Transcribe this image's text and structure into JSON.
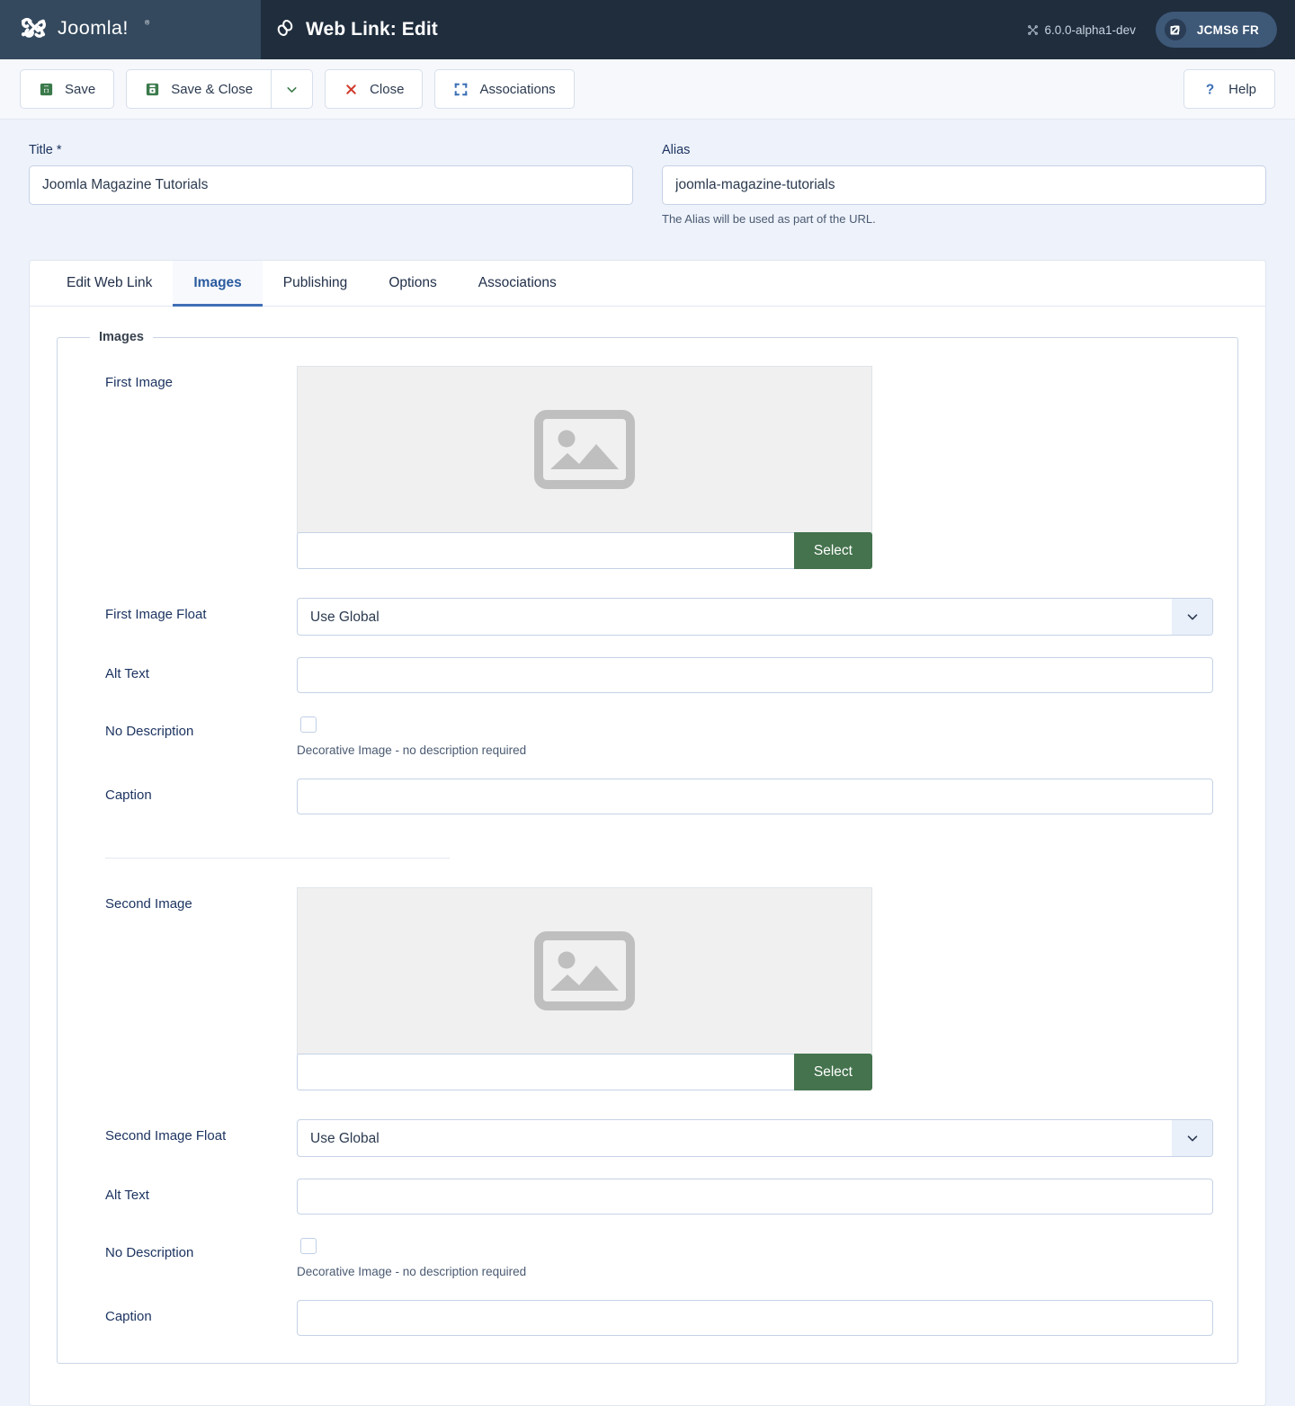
{
  "header": {
    "brand_name": "Joomla!",
    "page_title": "Web Link: Edit",
    "link_icon": "chain-link-icon",
    "version": "6.0.0-alpha1-dev",
    "user_label": "JCMS6 FR"
  },
  "toolbar": {
    "save_label": "Save",
    "save_close_label": "Save & Close",
    "close_label": "Close",
    "associations_label": "Associations",
    "help_label": "Help"
  },
  "fields": {
    "title_label": "Title *",
    "title_value": "Joomla Magazine Tutorials",
    "alias_label": "Alias",
    "alias_value": "joomla-magazine-tutorials",
    "alias_hint": "The Alias will be used as part of the URL."
  },
  "tabs": [
    {
      "label": "Edit Web Link",
      "active": false
    },
    {
      "label": "Images",
      "active": true
    },
    {
      "label": "Publishing",
      "active": false
    },
    {
      "label": "Options",
      "active": false
    },
    {
      "label": "Associations",
      "active": false
    }
  ],
  "images_panel": {
    "legend": "Images",
    "select_button": "Select",
    "first": {
      "image_label": "First Image",
      "image_value": "",
      "float_label": "First Image Float",
      "float_value": "Use Global",
      "alt_label": "Alt Text",
      "alt_value": "",
      "no_desc_label": "No Description",
      "no_desc_hint": "Decorative Image - no description required",
      "caption_label": "Caption",
      "caption_value": ""
    },
    "second": {
      "image_label": "Second Image",
      "image_value": "",
      "float_label": "Second Image Float",
      "float_value": "Use Global",
      "alt_label": "Alt Text",
      "alt_value": "",
      "no_desc_label": "No Description",
      "no_desc_hint": "Decorative Image - no description required",
      "caption_label": "Caption",
      "caption_value": ""
    }
  },
  "colors": {
    "header_brand_bg": "#34495e",
    "header_main_bg": "#1f2d3d",
    "accent_blue": "#2b5b9e",
    "select_green": "#44734d",
    "close_red": "#d03a2c",
    "page_bg": "#eef2fa"
  }
}
